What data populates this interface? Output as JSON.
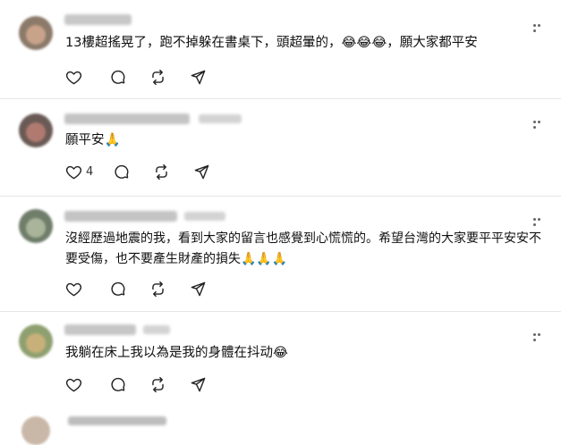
{
  "posts": [
    {
      "text": "13樓超搖晃了，跑不掉躲在書桌下，頭超暈的，😂😂😂，願大家都平安",
      "reply_count": "",
      "avatar_colors": [
        "#8b7a6a",
        "#c9a28a"
      ]
    },
    {
      "text": "願平安🙏",
      "reply_count": "4",
      "avatar_colors": [
        "#6a5a55",
        "#b07a70"
      ]
    },
    {
      "text": "沒經歷過地震的我，看到大家的留言也感覺到心慌慌的。希望台灣的大家要平平安安不要受傷，也不要產生財產的損失🙏🙏🙏",
      "reply_count": "",
      "avatar_colors": [
        "#6f7d6a",
        "#a9b49a"
      ]
    },
    {
      "text": "我躺在床上我以為是我的身體在抖动😂",
      "reply_count": "",
      "avatar_colors": [
        "#8fa070",
        "#c8b07a"
      ]
    }
  ],
  "icons": {
    "like": "heart-icon",
    "reply": "comment-icon",
    "repost": "repost-icon",
    "share": "send-icon",
    "more": "more-icon"
  }
}
